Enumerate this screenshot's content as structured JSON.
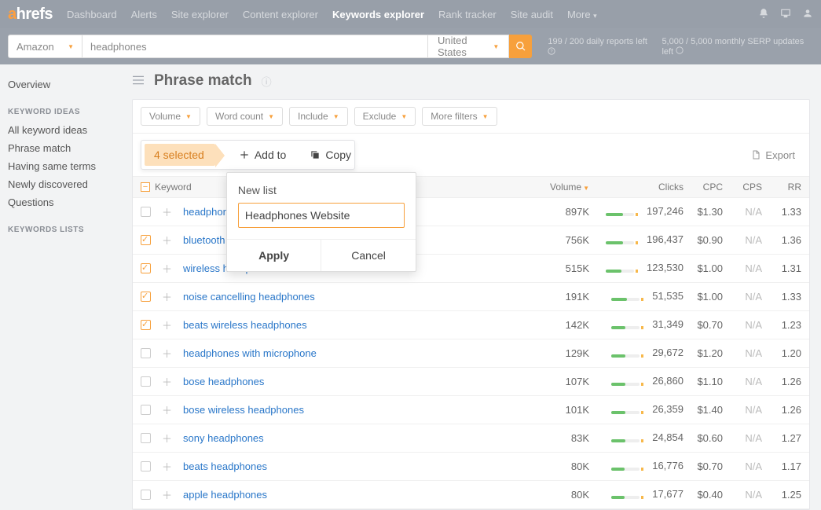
{
  "logo": {
    "a": "a",
    "rest": "hrefs"
  },
  "topnav": [
    "Dashboard",
    "Alerts",
    "Site explorer",
    "Content explorer",
    "Keywords explorer",
    "Rank tracker",
    "Site audit",
    "More"
  ],
  "topnav_active": 4,
  "engine": "Amazon",
  "query": "headphones",
  "country": "United States",
  "quota1": "199 / 200 daily reports left",
  "quota2": "5,000 / 5,000 monthly SERP updates left",
  "sidebar": {
    "overview": "Overview",
    "head1": "KEYWORD IDEAS",
    "items1": [
      "All keyword ideas",
      "Phrase match",
      "Having same terms",
      "Newly discovered",
      "Questions"
    ],
    "head2": "KEYWORDS LISTS"
  },
  "page_title": "Phrase match",
  "filters": [
    "Volume",
    "Word count",
    "Include",
    "Exclude",
    "More filters"
  ],
  "selected_label": "4 selected",
  "addto": "Add to",
  "copy": "Copy",
  "export": "Export",
  "thead": {
    "kw": "Keyword",
    "vol": "Volume",
    "clicks": "Clicks",
    "cpc": "CPC",
    "cps": "CPS",
    "rr": "RR"
  },
  "modal": {
    "title": "New list",
    "value": "Headphones Website",
    "apply": "Apply",
    "cancel": "Cancel"
  },
  "rows": [
    {
      "checked": false,
      "kw": "headphones",
      "vol": "897K",
      "clicks": "197,246",
      "cpc": "$1.30",
      "cps": "N/A",
      "rr": "1.33",
      "bar": 60
    },
    {
      "checked": true,
      "kw": "bluetooth headphones",
      "vol": "756K",
      "clicks": "196,437",
      "cpc": "$0.90",
      "cps": "N/A",
      "rr": "1.36",
      "bar": 60
    },
    {
      "checked": true,
      "kw": "wireless headphones",
      "vol": "515K",
      "clicks": "123,530",
      "cpc": "$1.00",
      "cps": "N/A",
      "rr": "1.31",
      "bar": 55
    },
    {
      "checked": true,
      "kw": "noise cancelling headphones",
      "vol": "191K",
      "clicks": "51,535",
      "cpc": "$1.00",
      "cps": "N/A",
      "rr": "1.33",
      "bar": 55
    },
    {
      "checked": true,
      "kw": "beats wireless headphones",
      "vol": "142K",
      "clicks": "31,349",
      "cpc": "$0.70",
      "cps": "N/A",
      "rr": "1.23",
      "bar": 50
    },
    {
      "checked": false,
      "kw": "headphones with microphone",
      "vol": "129K",
      "clicks": "29,672",
      "cpc": "$1.20",
      "cps": "N/A",
      "rr": "1.20",
      "bar": 50
    },
    {
      "checked": false,
      "kw": "bose headphones",
      "vol": "107K",
      "clicks": "26,860",
      "cpc": "$1.10",
      "cps": "N/A",
      "rr": "1.26",
      "bar": 50
    },
    {
      "checked": false,
      "kw": "bose wireless headphones",
      "vol": "101K",
      "clicks": "26,359",
      "cpc": "$1.40",
      "cps": "N/A",
      "rr": "1.26",
      "bar": 50
    },
    {
      "checked": false,
      "kw": "sony headphones",
      "vol": "83K",
      "clicks": "24,854",
      "cpc": "$0.60",
      "cps": "N/A",
      "rr": "1.27",
      "bar": 50
    },
    {
      "checked": false,
      "kw": "beats headphones",
      "vol": "80K",
      "clicks": "16,776",
      "cpc": "$0.70",
      "cps": "N/A",
      "rr": "1.17",
      "bar": 45
    },
    {
      "checked": false,
      "kw": "apple headphones",
      "vol": "80K",
      "clicks": "17,677",
      "cpc": "$0.40",
      "cps": "N/A",
      "rr": "1.25",
      "bar": 45
    }
  ]
}
